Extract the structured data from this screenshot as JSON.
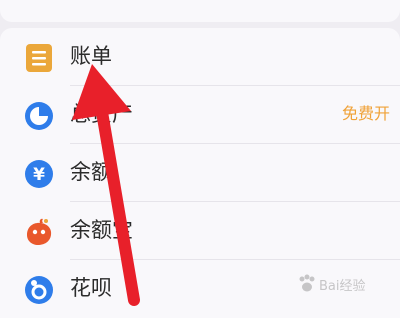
{
  "list": {
    "items": [
      {
        "label": "账单",
        "icon": "bill-icon",
        "extra": ""
      },
      {
        "label": "总资产",
        "icon": "pie-chart-icon",
        "extra": "免费开"
      },
      {
        "label": "余额",
        "icon": "yuan-coin-icon",
        "extra": ""
      },
      {
        "label": "余额宝",
        "icon": "yuebao-icon",
        "extra": ""
      },
      {
        "label": "花呗",
        "icon": "huabei-icon",
        "extra": ""
      }
    ]
  },
  "watermark": {
    "text": "Bai经验"
  },
  "colors": {
    "bill": "#eba73a",
    "asset": "#2f7dea",
    "balance": "#2f7dea",
    "yuebao": "#e9582c",
    "huabei": "#2f7dea",
    "arrow": "#e8202a",
    "accent_text": "#f0a238"
  }
}
